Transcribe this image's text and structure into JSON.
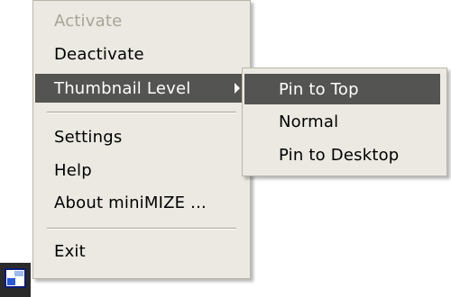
{
  "main_menu": {
    "items": [
      {
        "label": "Activate"
      },
      {
        "label": "Deactivate"
      },
      {
        "label": "Thumbnail Level"
      },
      {
        "label": "Settings"
      },
      {
        "label": "Help"
      },
      {
        "label": "About miniMIZE ..."
      },
      {
        "label": "Exit"
      }
    ]
  },
  "submenu": {
    "items": [
      {
        "label": "Pin to Top"
      },
      {
        "label": "Normal"
      },
      {
        "label": "Pin to Desktop"
      }
    ]
  },
  "tray": {
    "icon": "minimize-app-icon"
  }
}
